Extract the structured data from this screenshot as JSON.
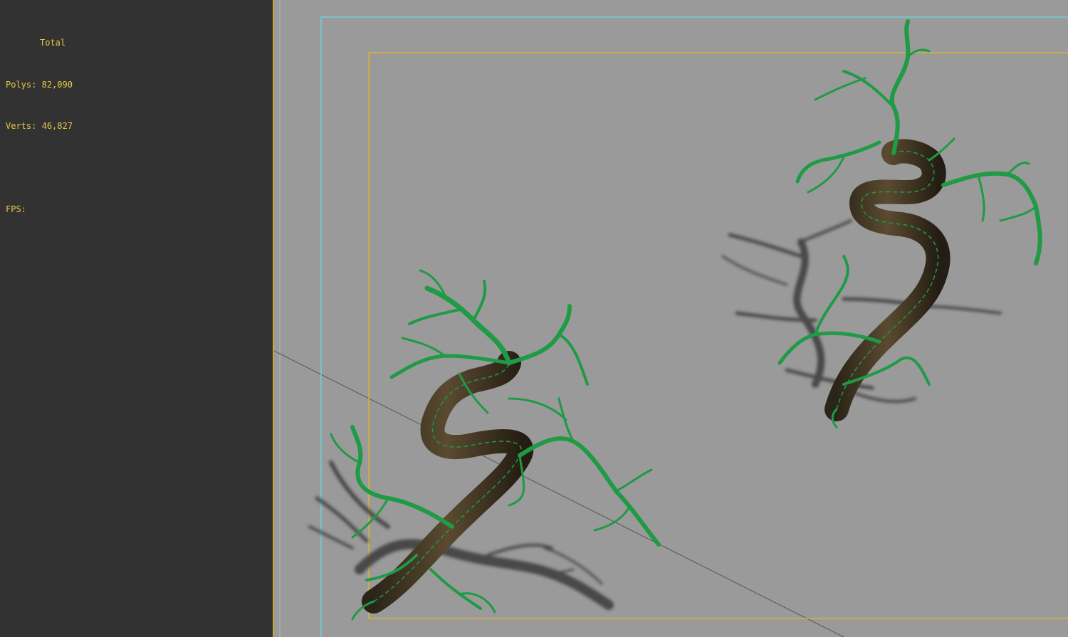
{
  "stats": {
    "title": "Total",
    "polys_label": "Polys:",
    "polys_value": "82,090",
    "verts_label": "Verts:",
    "verts_value": "46,827",
    "fps_label": "FPS:",
    "fps_value": ""
  },
  "viewport": {
    "background": "#9a9a9a",
    "safe_frame_color": "#6fd0d6",
    "render_frame_color": "#d6b23a",
    "mesh_color": "#1f9a45",
    "trunk_color": "#3b3020"
  },
  "scene": {
    "objects": [
      "bonsai-tree-left",
      "bonsai-tree-right"
    ]
  }
}
